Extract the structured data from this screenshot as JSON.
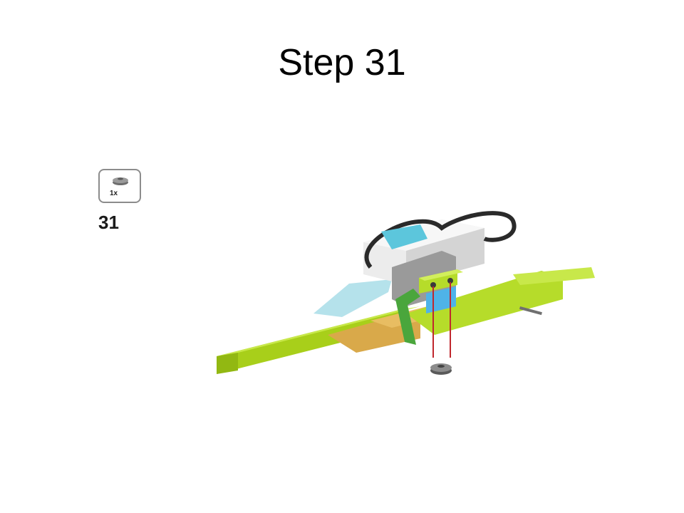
{
  "slide": {
    "title": "Step 31"
  },
  "parts_callout": {
    "count": "1x",
    "part_icon": "round-plate-icon"
  },
  "step": {
    "number": "31"
  },
  "illustration": {
    "icon": "lego-model-assembly-icon"
  }
}
